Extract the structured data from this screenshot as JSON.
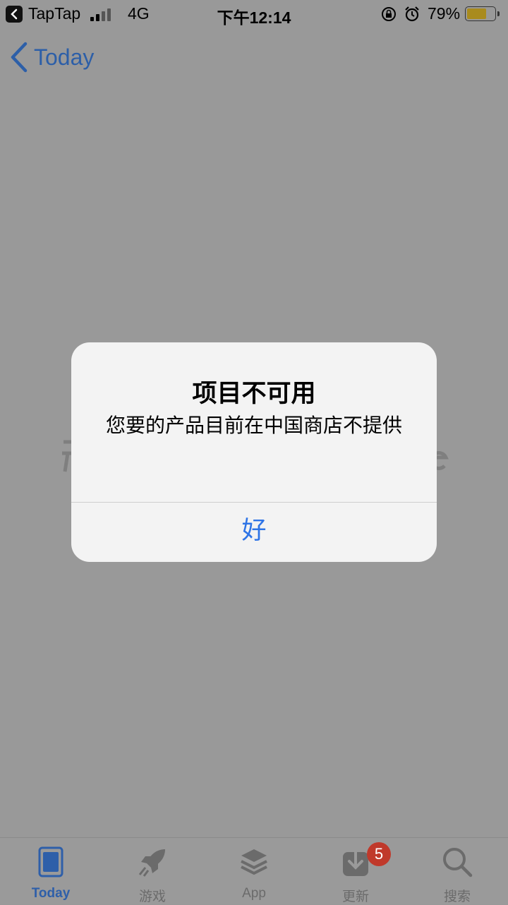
{
  "status_bar": {
    "back_app": "TapTap",
    "network": "4G",
    "time": "下午12:14",
    "battery": "79%",
    "battery_level": 0.79
  },
  "nav": {
    "back_label": "Today"
  },
  "alert": {
    "title": "项目不可用",
    "message": "您要的产品目前在中国商店不提供",
    "ok_label": "好"
  },
  "tab_bar": {
    "tabs": [
      {
        "label": "Today",
        "icon": "today-icon",
        "active": true
      },
      {
        "label": "游戏",
        "icon": "rocket-icon",
        "active": false
      },
      {
        "label": "App",
        "icon": "layers-icon",
        "active": false
      },
      {
        "label": "更新",
        "icon": "download-icon",
        "active": false
      },
      {
        "label": "搜索",
        "icon": "search-icon",
        "active": false
      }
    ],
    "updates_badge": "5"
  },
  "colors": {
    "accent": "#2e74e6",
    "tab_active": "#2e5fa9",
    "badge": "#c0392b",
    "dim_background": "#999999"
  }
}
